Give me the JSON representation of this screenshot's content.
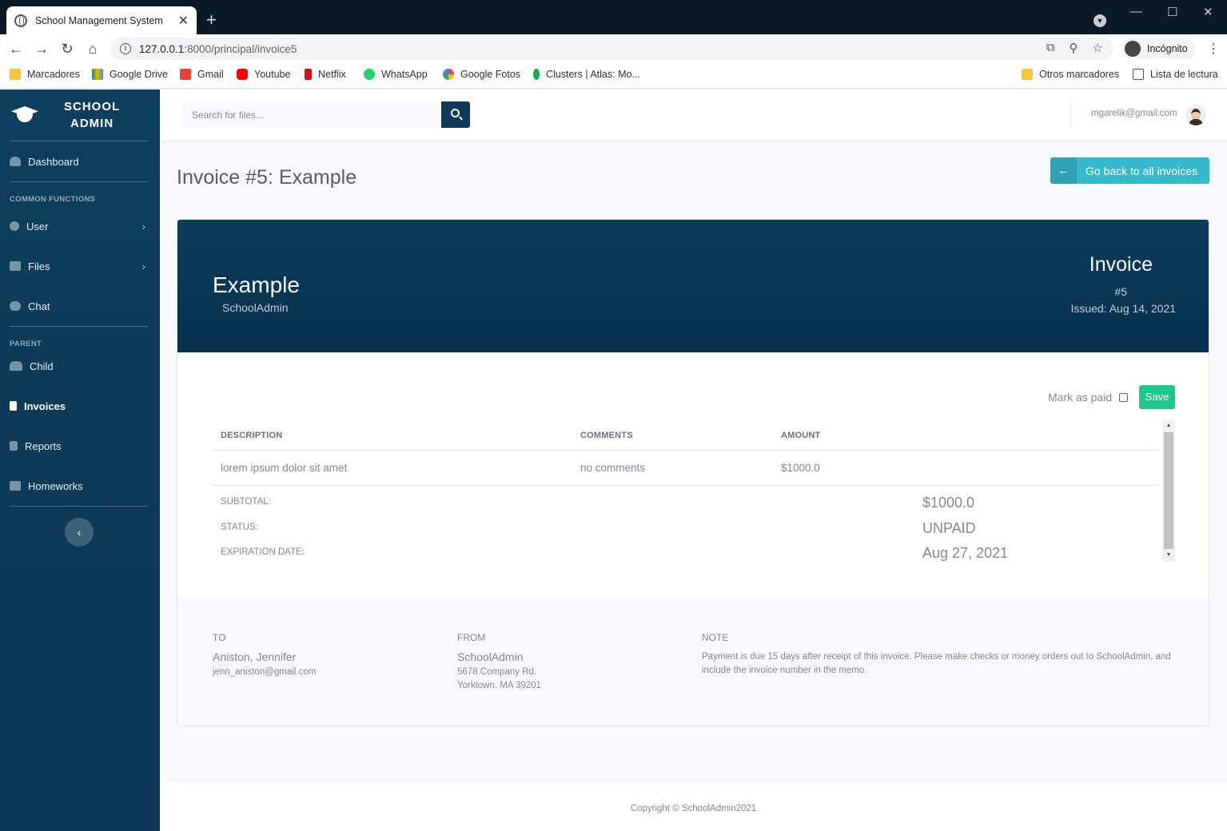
{
  "browser": {
    "tab_title": "School Management System",
    "url_host": "127.0.0.1",
    "url_path": ":8000/principal/invoice5",
    "profile": "Incógnito",
    "bookmarks": [
      "Marcadores",
      "Google Drive",
      "Gmail",
      "Youtube",
      "Netflix",
      "WhatsApp",
      "Google Fotos",
      "Clusters | Atlas: Mo..."
    ],
    "other_bookmarks": "Otros marcadores",
    "reading_list": "Lista de lectura"
  },
  "sidebar": {
    "brand_line1": "SCHOOL",
    "brand_line2": "ADMIN",
    "dashboard": "Dashboard",
    "heading_common": "COMMON FUNCTIONS",
    "user": "User",
    "files": "Files",
    "chat": "Chat",
    "heading_parent": "PARENT",
    "child": "Child",
    "invoices": "Invoices",
    "reports": "Reports",
    "homeworks": "Homeworks"
  },
  "topbar": {
    "search_placeholder": "Search for files...",
    "user_email": "mgarelik@gmail.com"
  },
  "main": {
    "page_title": "Invoice #5: Example",
    "back_button": "Go back to all invoices"
  },
  "invoice": {
    "company": "Example",
    "company_sub": "SchoolAdmin",
    "label": "Invoice",
    "number": "#5",
    "issued": "Issued: Aug 14, 2021",
    "mark_paid_label": "Mark as paid",
    "save_label": "Save",
    "columns": [
      "DESCRIPTION",
      "COMMENTS",
      "AMOUNT"
    ],
    "rows": [
      {
        "description": "lorem ipsum dolor sit amet",
        "comments": "no comments",
        "amount": "$1000.0"
      }
    ],
    "summary": {
      "subtotal_label": "SUBTOTAL:",
      "subtotal_value": "$1000.0",
      "status_label": "STATUS:",
      "status_value": "UNPAID",
      "expiration_label": "EXPIRATION DATE:",
      "expiration_value": "Aug 27, 2021"
    },
    "to": {
      "heading": "TO",
      "name": "Aniston, Jennifer",
      "email": "jenn_aniston@gmail.com"
    },
    "from": {
      "heading": "FROM",
      "name": "SchoolAdmin",
      "address1": "5678 Company Rd.",
      "address2": "Yorktown, MA 39201"
    },
    "note": {
      "heading": "NOTE",
      "text": "Payment is due 15 days after receipt of this invoice. Please make checks or money orders out to SchoolAdmin, and include the invoice number in the memo."
    }
  },
  "footer": {
    "copyright": "Copyright © SchoolAdmin2021"
  },
  "colors": {
    "sidebar": "#0e3f5e",
    "header": "#05314f",
    "info_button": "#36b9cc",
    "save_button": "#1cc88a"
  }
}
